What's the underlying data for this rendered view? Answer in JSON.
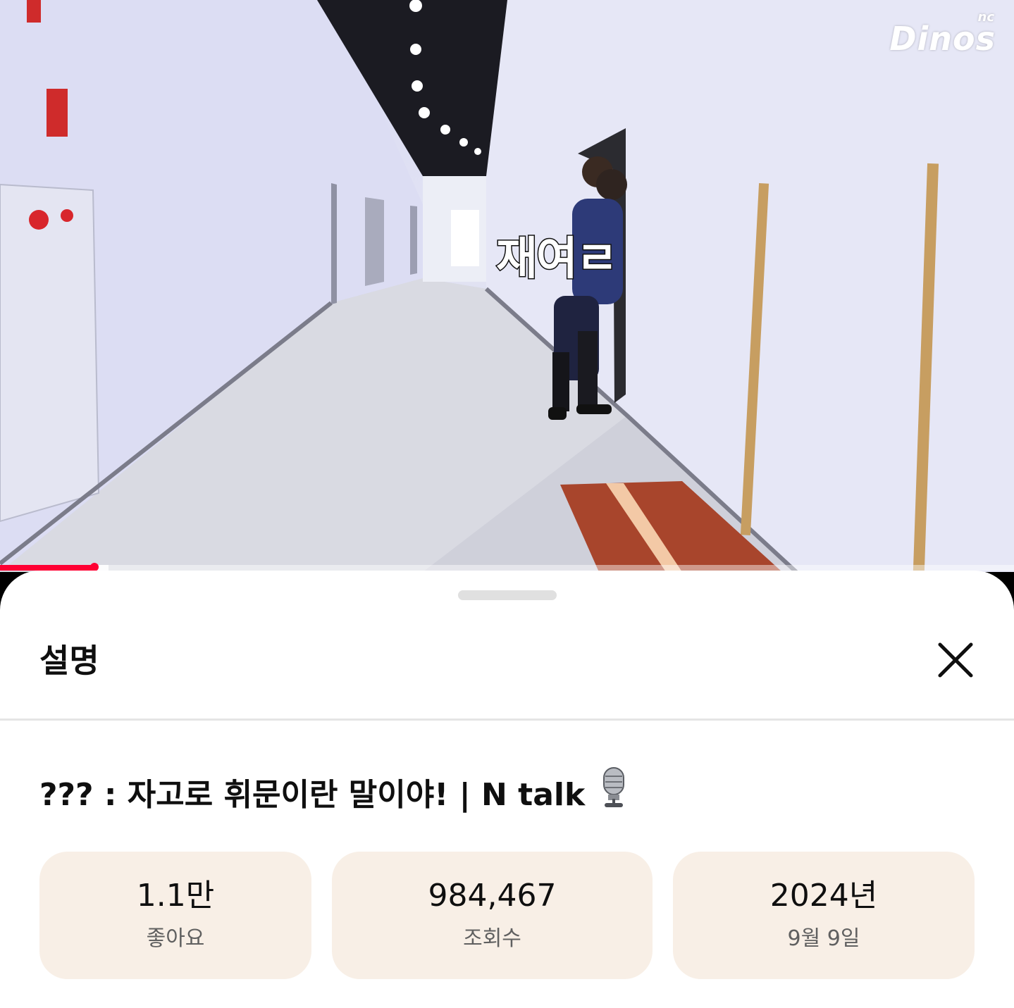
{
  "video": {
    "watermark_logo": "Dinos",
    "watermark_logo_small": "nc",
    "subtitle": "재여ㄹ",
    "progress_fraction": 0.093,
    "buffered_fraction": 0.107
  },
  "sheet": {
    "title": "설명",
    "close_icon": "close-icon"
  },
  "description": {
    "video_title": "??? : 자고로 휘문이란 말이야! | N talk",
    "title_emoji": "microphone-icon",
    "stats": [
      {
        "value": "1.1만",
        "label": "좋아요"
      },
      {
        "value": "984,467",
        "label": "조회수"
      },
      {
        "value": "2024년",
        "label": "9월 9일"
      }
    ]
  },
  "colors": {
    "progress_red": "#ff0033",
    "stat_background": "#f8efe6",
    "text_primary": "#0f0f0f",
    "text_secondary": "#606060"
  }
}
